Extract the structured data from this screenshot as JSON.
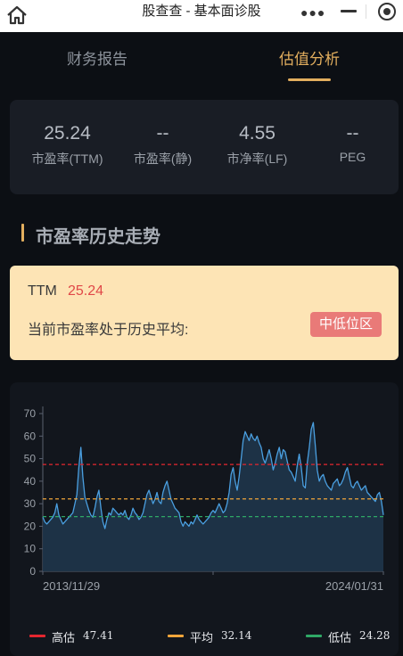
{
  "window": {
    "title": "股查查 - 基本面诊股"
  },
  "tabs": [
    {
      "label": "财务报告",
      "active": false
    },
    {
      "label": "估值分析",
      "active": true
    }
  ],
  "metrics": [
    {
      "value": "25.24",
      "label": "市盈率(TTM)"
    },
    {
      "value": "--",
      "label": "市盈率(静)"
    },
    {
      "value": "4.55",
      "label": "市净率(LF)"
    },
    {
      "value": "--",
      "label": "PEG"
    }
  ],
  "section": {
    "title": "市盈率历史走势"
  },
  "ttm_card": {
    "label": "TTM",
    "value": "25.24",
    "description": "当前市盈率处于历史平均:",
    "badge": "中低位区"
  },
  "colors": {
    "accent": "#e2ae5e",
    "high": "#e4262f",
    "average": "#f0a53a",
    "low": "#2fa866",
    "series": "#4a9fe0",
    "badge": "#e97a78"
  },
  "chart_data": {
    "type": "area",
    "x_start_label": "2013/11/29",
    "x_end_label": "2024/01/31",
    "ylim": [
      0,
      70
    ],
    "yticks": [
      0,
      10,
      20,
      30,
      40,
      50,
      60,
      70
    ],
    "reference_lines": [
      {
        "name": "高估",
        "value": 47.41,
        "style": "dashed",
        "color": "#e4262f"
      },
      {
        "name": "平均",
        "value": 32.14,
        "style": "dashed",
        "color": "#f0a53a"
      },
      {
        "name": "低估",
        "value": 24.28,
        "style": "dashed",
        "color": "#2fa866"
      }
    ],
    "legend_placement": "bottom",
    "values": [
      24,
      22,
      21,
      22,
      23,
      24,
      26,
      30,
      25,
      23,
      21,
      22,
      23,
      24,
      25,
      26,
      30,
      34,
      46,
      55,
      42,
      33,
      30,
      27,
      25,
      24,
      28,
      33,
      36,
      28,
      22,
      19,
      23,
      26,
      25,
      28,
      27,
      26,
      25,
      26,
      25,
      27,
      24,
      23,
      25,
      28,
      26,
      25,
      23,
      24,
      26,
      30,
      34,
      36,
      33,
      30,
      32,
      35,
      31,
      30,
      35,
      38,
      40,
      36,
      32,
      30,
      28,
      27,
      26,
      22,
      20,
      22,
      21,
      20,
      22,
      21,
      23,
      25,
      23,
      22,
      21,
      22,
      23,
      24,
      26,
      27,
      26,
      28,
      30,
      28,
      26,
      27,
      30,
      35,
      43,
      46,
      40,
      36,
      42,
      50,
      58,
      62,
      60,
      58,
      61,
      59,
      58,
      60,
      57,
      55,
      50,
      48,
      51,
      54,
      50,
      45,
      48,
      52,
      55,
      50,
      54,
      53,
      49,
      45,
      44,
      42,
      40,
      47,
      52,
      46,
      38,
      37,
      48,
      55,
      63,
      66,
      56,
      45,
      40,
      42,
      43,
      40,
      38,
      37,
      36,
      39,
      40,
      41,
      38,
      39,
      41,
      44,
      46,
      42,
      38,
      37,
      39,
      40,
      38,
      36,
      37,
      38,
      35,
      34,
      33,
      32,
      31,
      34,
      35,
      31,
      25
    ]
  },
  "legend": [
    {
      "name": "高估",
      "value": "47.41"
    },
    {
      "name": "平均",
      "value": "32.14"
    },
    {
      "name": "低估",
      "value": "24.28"
    }
  ]
}
